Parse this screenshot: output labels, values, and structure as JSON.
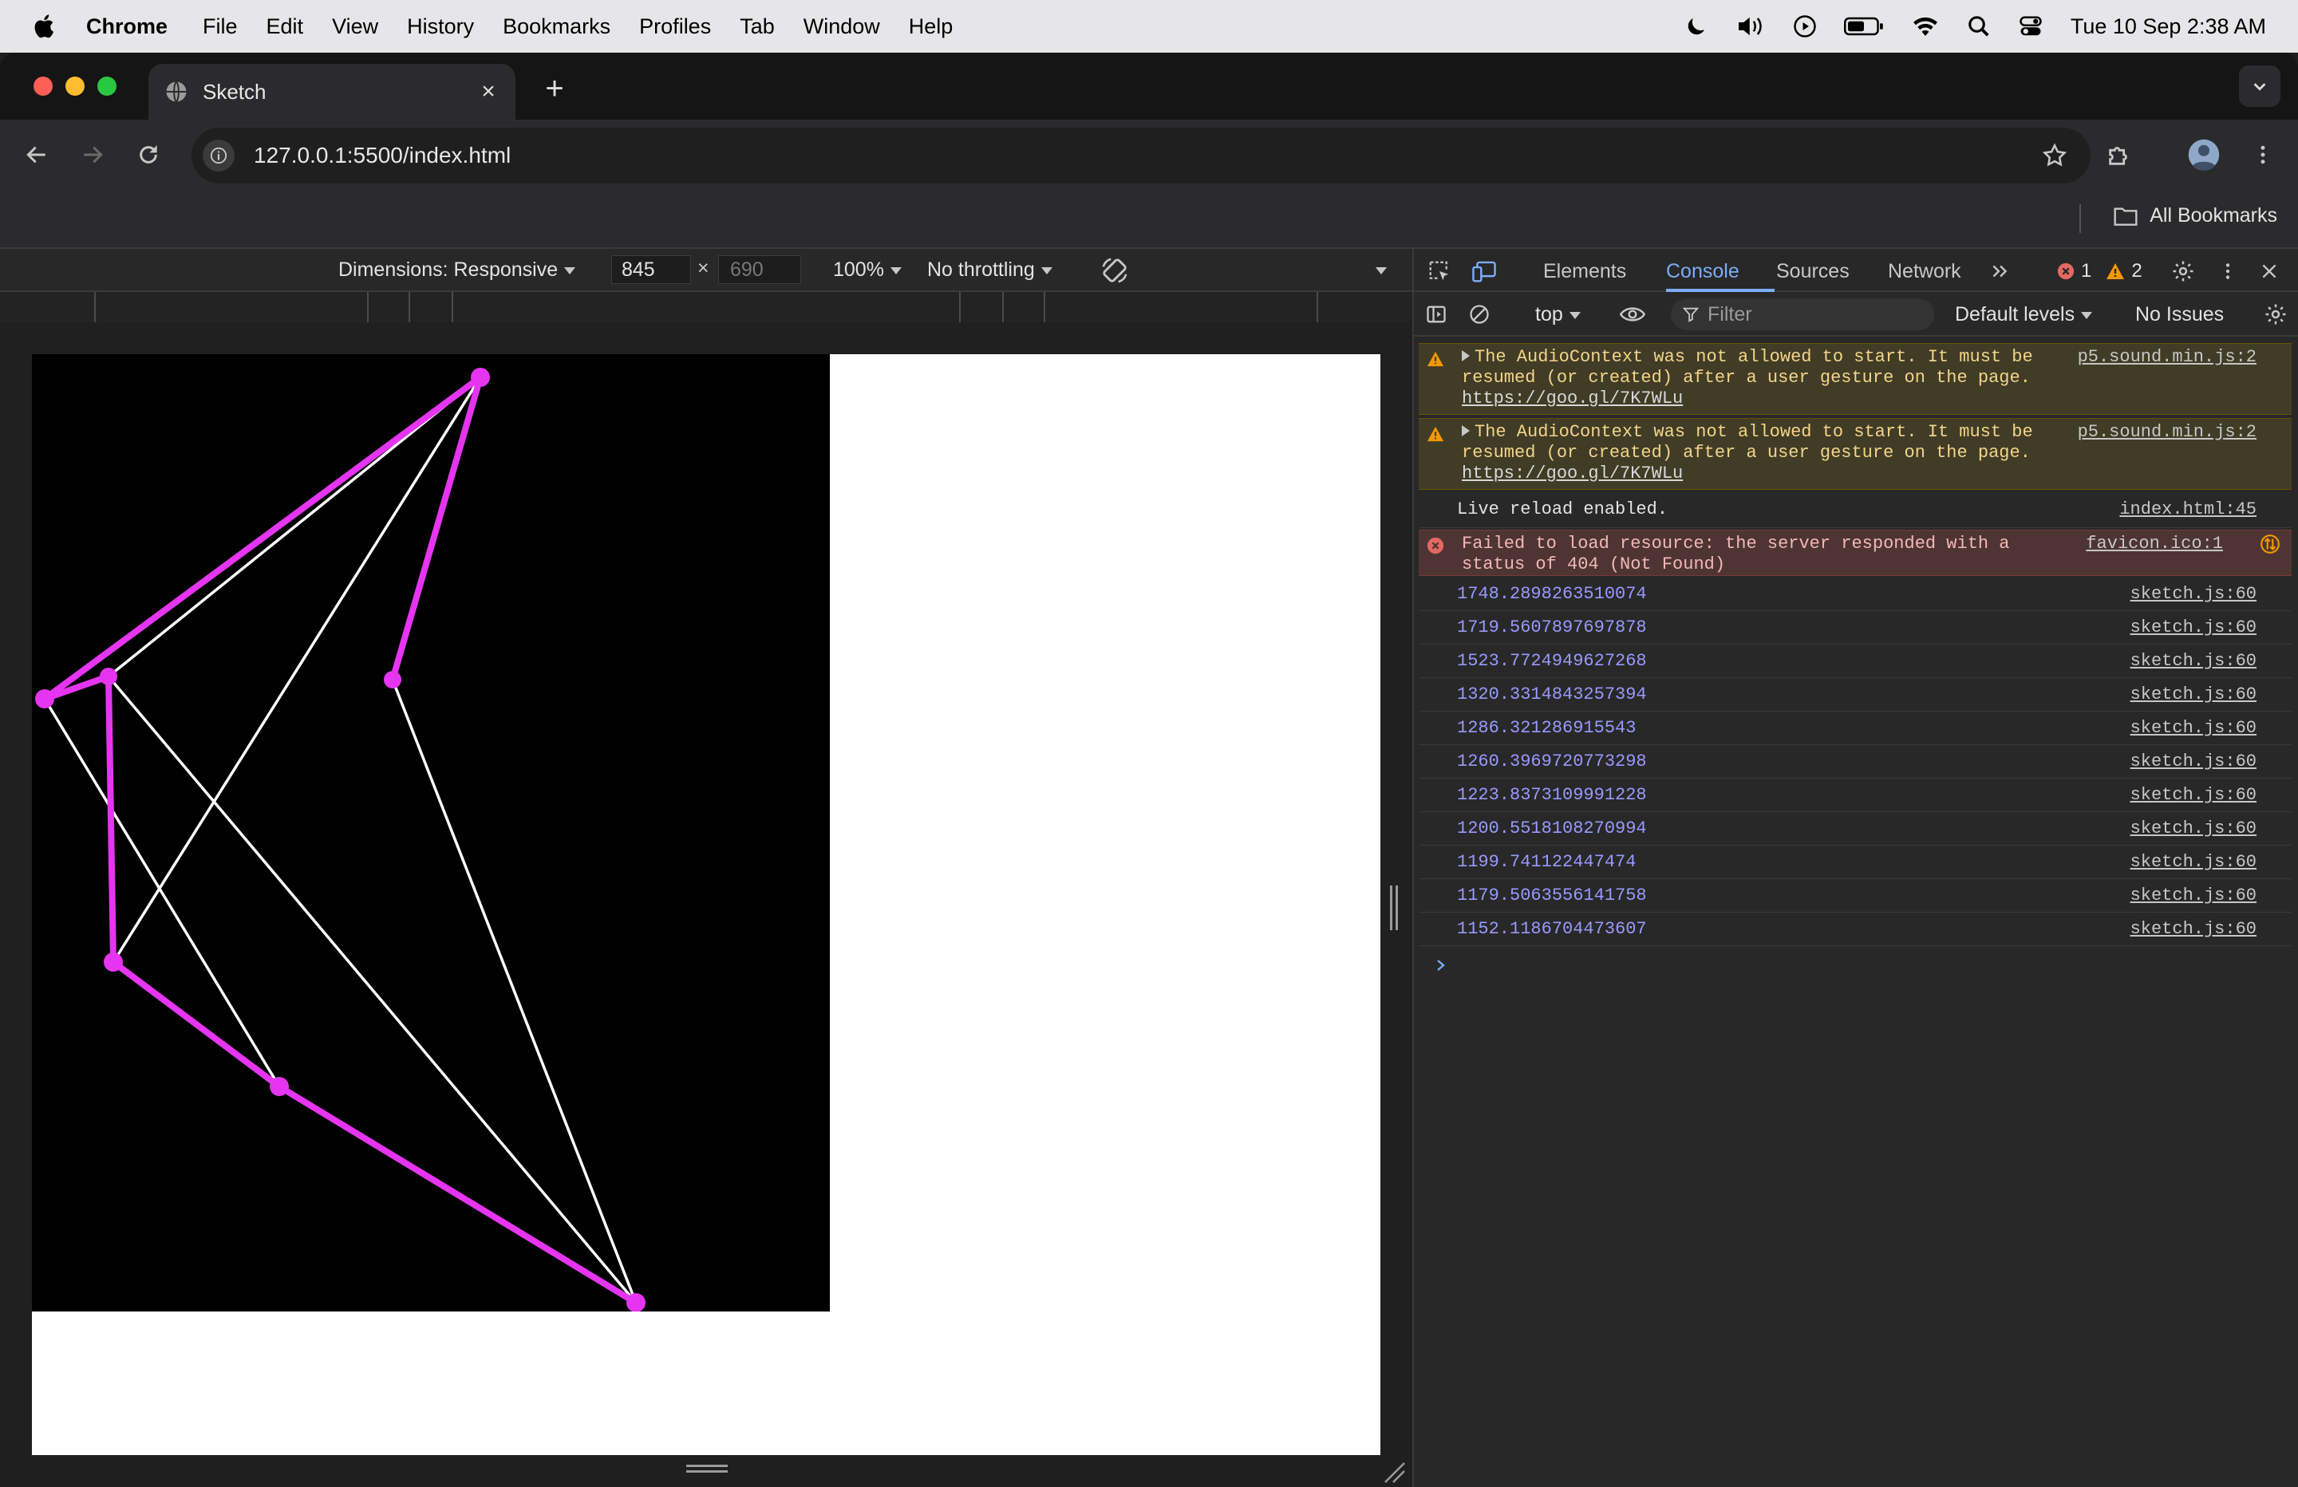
{
  "menubar": {
    "app": "Chrome",
    "items": [
      "File",
      "Edit",
      "View",
      "History",
      "Bookmarks",
      "Profiles",
      "Tab",
      "Window",
      "Help"
    ],
    "clock": "Tue 10 Sep  2:38 AM"
  },
  "tab": {
    "title": "Sketch",
    "close": "×"
  },
  "newtab": "+",
  "omnibox": {
    "url": "127.0.0.1:5500/index.html"
  },
  "bookmarks": {
    "all_label": "All Bookmarks"
  },
  "device_toolbar": {
    "dimensions_label": "Dimensions: Responsive",
    "width": "845",
    "times": "×",
    "height_placeholder": "690",
    "zoom": "100%",
    "throttle": "No throttling"
  },
  "devtools": {
    "tabs": [
      "Elements",
      "Console",
      "Sources",
      "Network"
    ],
    "active_tab": "Console",
    "error_count": "1",
    "warning_count": "2",
    "context": "top",
    "filter_placeholder": "Filter",
    "levels": "Default levels",
    "issues": "No Issues"
  },
  "console": {
    "warnings": [
      {
        "text": "The AudioContext was not allowed to start. It must be resumed (or created) after a user gesture on the page.",
        "link": "https://goo.gl/7K7WLu",
        "source": "p5.sound.min.js:2"
      },
      {
        "text": "The AudioContext was not allowed to start. It must be resumed (or created) after a user gesture on the page.",
        "link": "https://goo.gl/7K7WLu",
        "source": "p5.sound.min.js:2"
      }
    ],
    "info": {
      "text": "Live reload enabled.",
      "source": "index.html:45"
    },
    "error": {
      "text": "Failed to load resource: the server responded with a status of 404 (Not Found)",
      "source": "favicon.ico:1"
    },
    "logs": [
      {
        "value": "1748.2898263510074",
        "source": "sketch.js:60"
      },
      {
        "value": "1719.5607897697878",
        "source": "sketch.js:60"
      },
      {
        "value": "1523.7724949627268",
        "source": "sketch.js:60"
      },
      {
        "value": "1320.3314843257394",
        "source": "sketch.js:60"
      },
      {
        "value": "1286.321286915543",
        "source": "sketch.js:60"
      },
      {
        "value": "1260.3969720773298",
        "source": "sketch.js:60"
      },
      {
        "value": "1223.8373109991228",
        "source": "sketch.js:60"
      },
      {
        "value": "1200.5518108270994",
        "source": "sketch.js:60"
      },
      {
        "value": "1199.741122447474",
        "source": "sketch.js:60"
      },
      {
        "value": "1179.5063556141758",
        "source": "sketch.js:60"
      },
      {
        "value": "1152.1186704473607",
        "source": "sketch.js:60"
      }
    ]
  },
  "colors": {
    "accent": "#7cacf8",
    "sketch_path": "#e535f0",
    "sketch_lines": "#ffffff",
    "sketch_background": "#000000"
  }
}
